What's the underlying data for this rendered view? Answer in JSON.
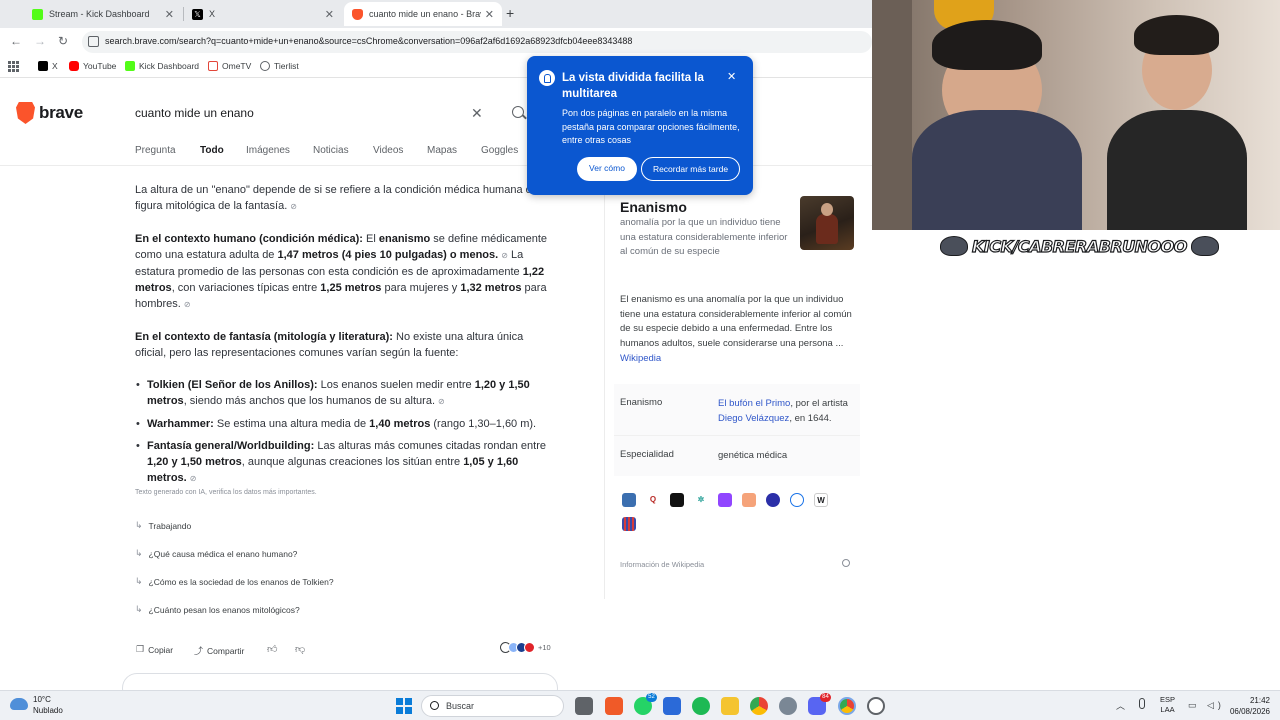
{
  "browser": {
    "tabs": [
      {
        "label": "Stream - Kick Dashboard",
        "icon": "kick-icon"
      },
      {
        "label": "X",
        "icon": "x-icon"
      },
      {
        "label": "cuanto mide un enano - Brave",
        "icon": "brave-icon"
      }
    ],
    "url": "search.brave.com/search?q=cuanto+mide+un+enano&source=csChrome&conversation=096af2af6d1692a68923dfcb04eee8343488",
    "bookmarks": [
      {
        "label": "X",
        "icon": "x-icon"
      },
      {
        "label": "YouTube",
        "icon": "youtube-icon"
      },
      {
        "label": "Kick Dashboard",
        "icon": "kick-icon"
      },
      {
        "label": "OmeTV",
        "icon": "ometv-icon"
      },
      {
        "label": "Tierlist",
        "icon": "tierlist-icon"
      }
    ]
  },
  "search": {
    "logo_text": "brave",
    "query": "cuanto mide un enano",
    "tabs": [
      "Pregunta",
      "Todo",
      "Imágenes",
      "Noticias",
      "Videos",
      "Mapas",
      "Goggles"
    ],
    "active_tab": "Todo"
  },
  "answer": {
    "intro": "La altura de un \"enano\" depende de si se refiere a la condición médica humana o a la figura mitológica de la fantasía.",
    "human_heading": "En el contexto humano (condición médica):",
    "human_text_1": "El",
    "human_term": "enanismo",
    "human_text_2": "se define médicamente como una estatura adulta de",
    "human_height": "1,47 metros (4 pies 10 pulgadas) o menos.",
    "human_text_3": "La estatura promedio de las personas con esta condición es de aproximadamente",
    "human_avg": "1,22 metros",
    "human_text_4": ", con variaciones típicas entre",
    "human_women": "1,25 metros",
    "human_text_5": "para mujeres y",
    "human_men": "1,32 metros",
    "human_text_6": "para hombres.",
    "fantasy_heading": "En el contexto de fantasía (mitología y literatura):",
    "fantasy_text": "No existe una altura única oficial, pero las representaciones comunes varían según la fuente:",
    "bullets": [
      {
        "heading": "Tolkien (El Señor de los Anillos):",
        "text_1": "Los enanos suelen medir entre",
        "value": "1,20 y 1,50 metros",
        "text_2": ", siendo más anchos que los humanos de su altura."
      },
      {
        "heading": "Warhammer:",
        "text_1": "Se estima una altura media de",
        "value": "1,40 metros",
        "text_2": "(rango 1,30–1,60 m)."
      },
      {
        "heading": "Fantasía general/Worldbuilding:",
        "text_1": "Las alturas más comunes citadas rondan entre",
        "value": "1,20 y 1,50 metros",
        "text_2": ", aunque algunas creaciones los sitúan entre",
        "value_2": "1,05 y 1,60 metros."
      }
    ],
    "disclaimer": "Texto generado con IA, verifica los datos más importantes.",
    "followups": [
      "Trabajando",
      "¿Qué causa médica el enano humano?",
      "¿Cómo es la sociedad de los enanos de Tolkien?",
      "¿Cuánto pesan los enanos mitológicos?"
    ],
    "copy_label": "Copiar",
    "share_label": "Compartir",
    "sources_more": "+10"
  },
  "knowledge_panel": {
    "title": "Enanismo",
    "subtitle": "anomalía por la que un individuo tiene una estatura considerablemente inferior al común de su especie",
    "description": "El enanismo es una anomalía por la que un individuo tiene una estatura considerablemente inferior al común de su especie debido a una enfermedad. Entre los humanos adultos, suele considerarse una persona ...",
    "wiki_link": "Wikipedia",
    "rows": [
      {
        "label": "Enanismo",
        "link": "El bufón el Primo",
        "text_1": ", por el artista",
        "link_2": "Diego Velázquez",
        "text_2": ", en 1644."
      },
      {
        "label": "Especialidad",
        "value": "genética médica"
      }
    ],
    "footer": "Información de Wikipedia"
  },
  "popup": {
    "title": "La vista dividida facilita la multitarea",
    "body": "Pon dos páginas en paralelo en la misma pestaña para comparar opciones fácilmente, entre otras cosas",
    "primary_button": "Ver cómo",
    "secondary_button": "Recordar más tarde"
  },
  "stream_overlay": {
    "channel_tag": "KICK/CABRERABRUNOOO"
  },
  "taskbar": {
    "temperature": "10°C",
    "condition": "Nublado",
    "search_placeholder": "Buscar",
    "whatsapp_badge": "52",
    "discord_badge": "84",
    "lang_line_1": "ESP",
    "lang_line_2": "LAA",
    "time": "21:42",
    "date": "06/08/2026"
  }
}
